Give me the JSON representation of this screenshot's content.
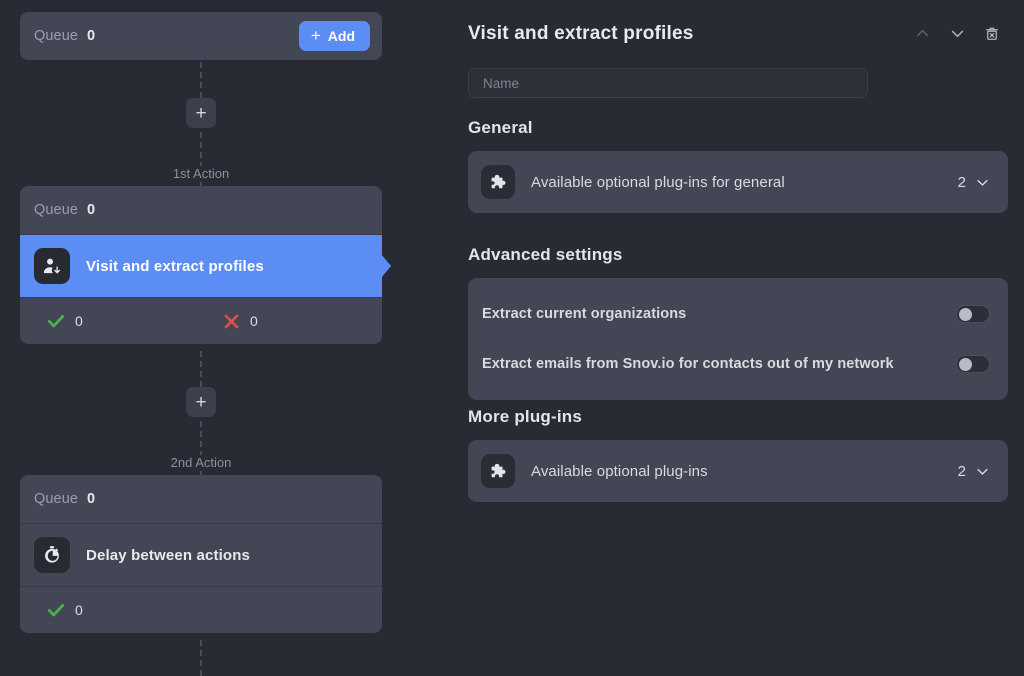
{
  "flow": {
    "start_node": {
      "queue_label": "Queue",
      "queue_count": "0",
      "add_button_label": "Add",
      "add_button_icon": "plus-icon"
    },
    "connectors": [
      {
        "plus_icon": "plus-icon",
        "step_label": "1st Action"
      },
      {
        "plus_icon": "plus-icon",
        "step_label": "2nd Action"
      }
    ],
    "nodes": [
      {
        "queue_label": "Queue",
        "queue_count": "0",
        "action_title": "Visit and extract profiles",
        "action_icon": "person-download-icon",
        "selected": true,
        "success_icon": "check-icon",
        "success_count": "0",
        "fail_icon": "cross-icon",
        "fail_count": "0"
      },
      {
        "queue_label": "Queue",
        "queue_count": "0",
        "action_title": "Delay between actions",
        "action_icon": "stopwatch-icon",
        "selected": false,
        "success_icon": "check-icon",
        "success_count": "0"
      }
    ]
  },
  "settings": {
    "title": "Visit and extract profiles",
    "header_icons": {
      "move_up": "chevron-up-icon",
      "move_down": "chevron-down-icon",
      "delete": "trash-icon"
    },
    "name_field": {
      "value": "",
      "placeholder": "Name"
    },
    "sections": [
      {
        "title": "General",
        "plugin_row": {
          "icon": "puzzle-piece-icon",
          "label": "Available optional plug-ins for general",
          "count": "2",
          "chevron": "chevron-down-icon"
        }
      },
      {
        "title": "Advanced settings",
        "toggles": [
          {
            "label": "Extract current organizations",
            "state": "off"
          },
          {
            "label": "Extract emails from Snov.io for contacts out of my network",
            "state": "off"
          }
        ]
      },
      {
        "title": "More plug-ins",
        "plugin_row": {
          "icon": "puzzle-piece-icon",
          "label": "Available optional plug-ins",
          "count": "2",
          "chevron": "chevron-down-icon"
        }
      }
    ]
  },
  "colors": {
    "background": "#282b33",
    "card": "#434654",
    "accent_blue": "#5b8df5",
    "success_green": "#4caf50",
    "error_red": "#e04b4b"
  }
}
